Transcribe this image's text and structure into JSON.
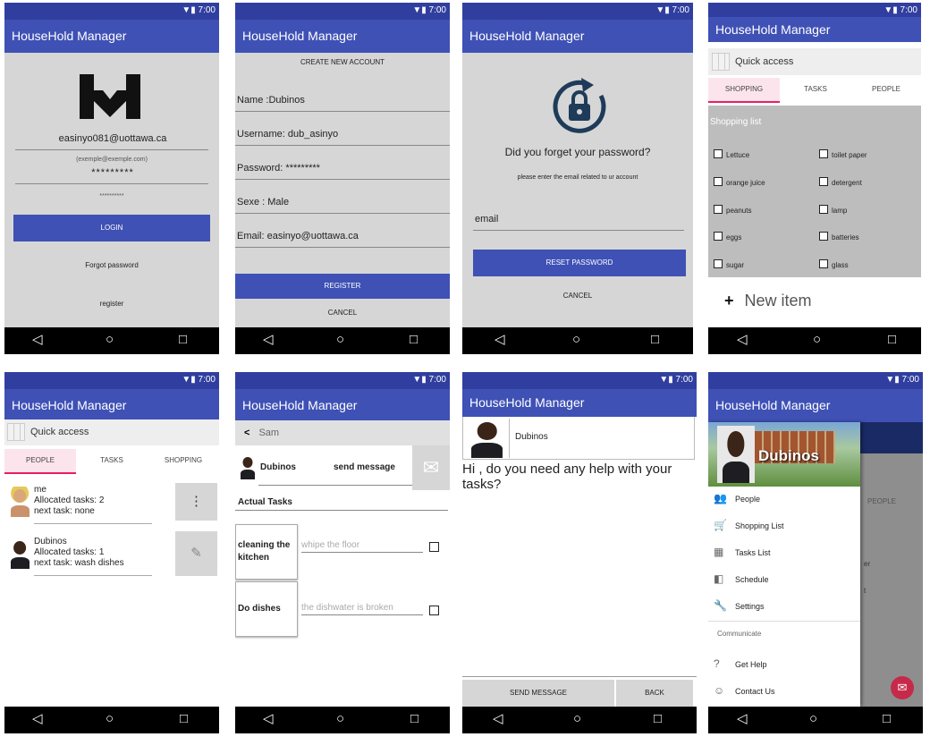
{
  "status_time": "7:00",
  "status_icons": "▼▮",
  "app_title": "HouseHold Manager",
  "nav": {
    "back": "◁",
    "home": "○",
    "recent": "□"
  },
  "login": {
    "email": "easinyo081@uottawa.ca",
    "email_hint": "(exemple@exemple.com)",
    "password_stars": "*********",
    "password_hint": "**********",
    "login_button": "LOGIN",
    "forgot_link": "Forgot password",
    "register_link": "register"
  },
  "create": {
    "heading": "CREATE NEW ACCOUNT",
    "fields": [
      "Name :Dubinos",
      "Username: dub_asinyo",
      "Password: *********",
      "Sexe : Male",
      "Email: easinyo@uottawa.ca"
    ],
    "register_button": "REGISTER",
    "cancel_button": "CANCEL"
  },
  "forgot": {
    "question": "Did you forget your password?",
    "instruction": "please enter the email related to ur account",
    "email_value": "email",
    "reset_button": "RESET PASSWORD",
    "cancel_button": "CANCEL"
  },
  "shopping": {
    "quick_access": "Quick access",
    "tabs": [
      "SHOPPING",
      "TASKS",
      "PEOPLE"
    ],
    "list_title": "Shopping list",
    "left_items": [
      "Lettuce",
      "orange juice",
      "peanuts",
      "eggs",
      "sugar"
    ],
    "right_items": [
      "toilet paper",
      "detergent",
      "lamp",
      "batteries",
      "glass"
    ],
    "plus": "+",
    "new_item": "New item"
  },
  "people": {
    "quick_access": "Quick access",
    "tabs": [
      "PEOPLE",
      "TASKS",
      "SHOPPING"
    ],
    "persons": [
      {
        "name": "me",
        "allocated": "Allocated tasks: 2",
        "next": "next task: none",
        "action": "⋮"
      },
      {
        "name": "Dubinos",
        "allocated": "Allocated tasks: 1",
        "next": "next task: wash dishes",
        "action": "✎"
      }
    ]
  },
  "tasks": {
    "back_arrow": "<",
    "back_name": "Sam",
    "person": "Dubinos",
    "send_message": "send message",
    "mail_icon": "✉",
    "actual_tasks": "Actual Tasks",
    "items": [
      {
        "title": "cleaning the kitchen",
        "note": "whipe the floor"
      },
      {
        "title": "Do dishes",
        "note": "the dishwater is broken"
      }
    ]
  },
  "message": {
    "person": "Dubinos",
    "text": "Hi , do you need any help with your tasks?",
    "send_button": "SEND MESSAGE",
    "back_button": "BACK"
  },
  "drawer": {
    "profile_name": "Dubinos",
    "behind_tab": "PEOPLE",
    "behind_text1": "er",
    "behind_text2": "t",
    "items": [
      {
        "icon": "👥",
        "label": "People"
      },
      {
        "icon": "🛒",
        "label": "Shopping List"
      },
      {
        "icon": "▦",
        "label": "Tasks List"
      },
      {
        "icon": "◧",
        "label": "Schedule"
      },
      {
        "icon": "🔧",
        "label": "Settings"
      }
    ],
    "section": "Communicate",
    "comm_items": [
      {
        "icon": "?",
        "label": "Get Help"
      },
      {
        "icon": "☺",
        "label": "Contact Us"
      }
    ],
    "fab_icon": "✉"
  }
}
